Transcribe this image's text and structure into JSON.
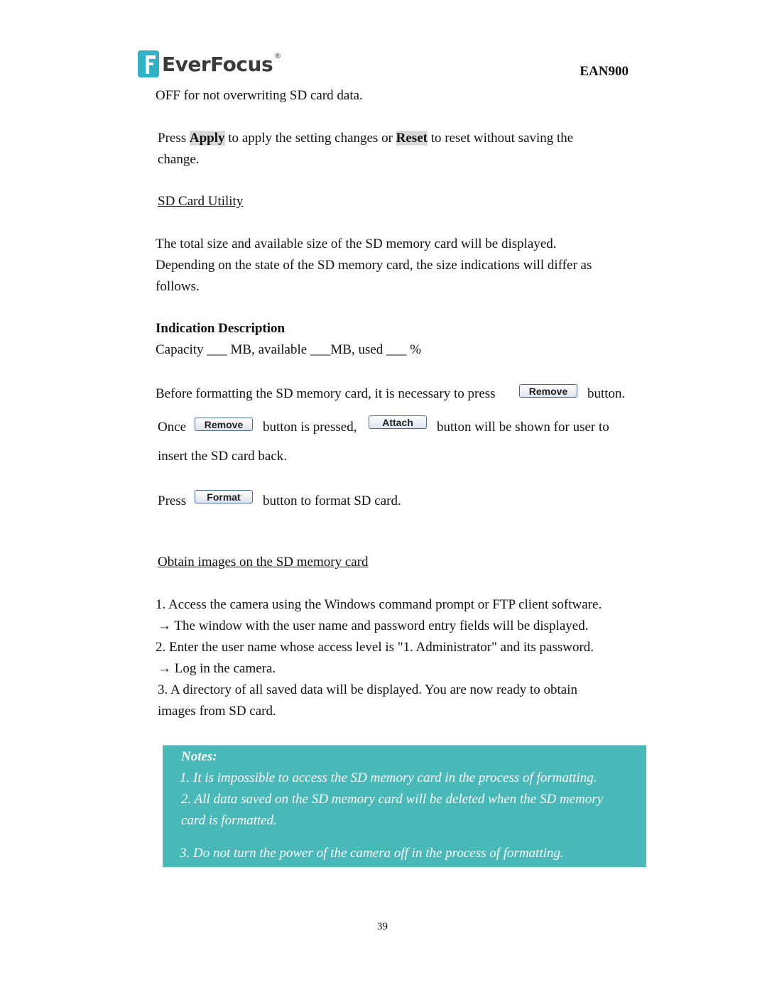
{
  "header": {
    "logo_text": "EverFocus",
    "logo_reg": "®",
    "model": "EAN900"
  },
  "body": {
    "line_overwrite": "OFF for not overwriting SD card data.",
    "apply_line": {
      "press": "Press ",
      "apply": "Apply",
      "mid": " to apply the setting changes or ",
      "reset": "Reset",
      "end": " to reset without saving the",
      "cont": "change."
    },
    "sd_utility_heading": "SD Card Utility",
    "sd_desc": [
      "The total size and available size of the SD memory card will be displayed.",
      "Depending on the state of the SD memory card, the size indications will differ as",
      "follows."
    ],
    "indication_heading": "Indication Description",
    "capacity_line": "Capacity ___ MB, available ___MB, used ___ %",
    "before_format": {
      "text": "Before formatting the SD memory card, it is necessary to press",
      "button": "Remove",
      "end": "button."
    },
    "once_line": {
      "once": "Once",
      "remove_button": "Remove",
      "mid": "button is pressed,",
      "attach_button": "Attach",
      "end": "button will be shown for user to",
      "cont": "insert the SD card back."
    },
    "format_line": {
      "press": "Press",
      "button": "Format",
      "end": "button to format SD card."
    },
    "obtain_heading": "Obtain images on the SD memory card",
    "steps": [
      "1. Access the camera using the Windows command prompt or FTP client software.",
      "→ The window with the user name and password entry fields will be displayed.",
      "2. Enter the user name whose access level is \"1. Administrator\" and its password.",
      "→ Log in the camera.",
      "3. A directory of all saved data will be displayed. You are now ready to obtain",
      "images from SD card."
    ]
  },
  "notes": {
    "title": "Notes:",
    "items": [
      "1. It is impossible to access the SD memory card in the process of formatting.",
      "2. All data saved on the SD memory card will be deleted when the SD memory",
      "card is formatted.",
      "3. Do not turn the power of the camera off in the process of formatting."
    ],
    "bg_color": "#49b8b8"
  },
  "footer": {
    "page_number": "39"
  }
}
